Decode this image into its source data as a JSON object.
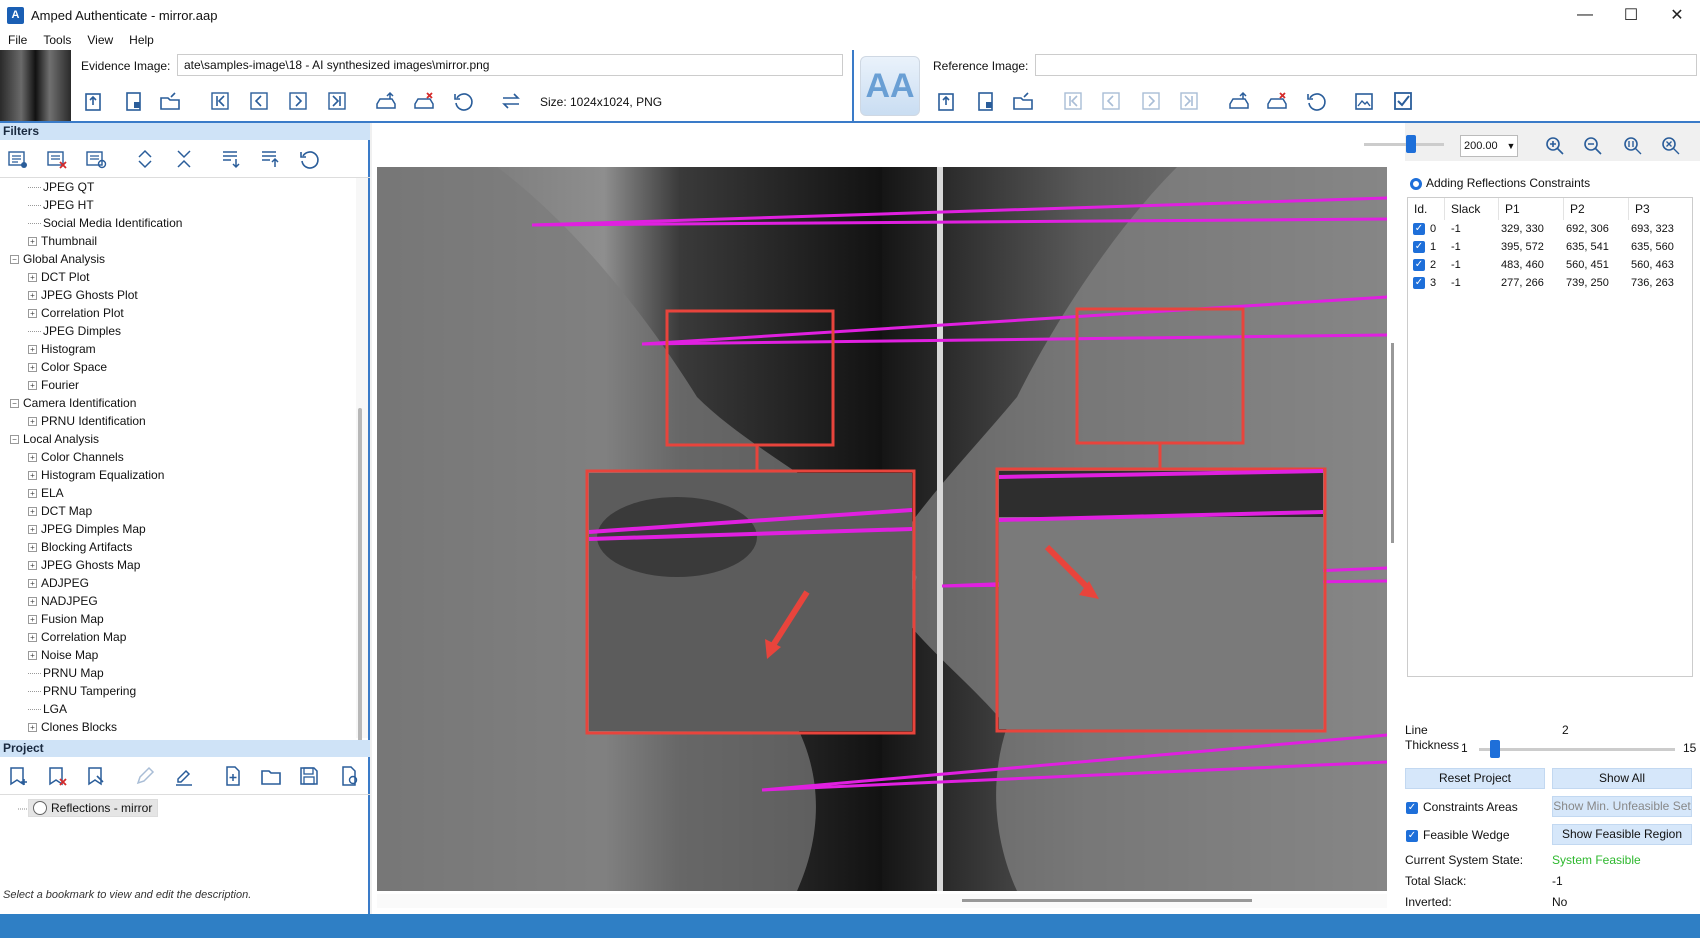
{
  "window": {
    "title": "Amped Authenticate - mirror.aap",
    "logo_text": "A",
    "minimize": "—",
    "maximize": "☐",
    "close": "✕"
  },
  "menu": [
    "File",
    "Tools",
    "View",
    "Help"
  ],
  "evidence": {
    "label": "Evidence Image:",
    "path": "ate\\samples-image\\18 - AI synthesized images\\mirror.png",
    "size_info": "Size: 1024x1024, PNG"
  },
  "reference": {
    "label": "Reference Image:",
    "path": "",
    "logo_text": "AA"
  },
  "filters": {
    "header": "Filters",
    "tree": [
      {
        "label": "JPEG QT",
        "level": 2,
        "expandable": false
      },
      {
        "label": "JPEG HT",
        "level": 2,
        "expandable": false
      },
      {
        "label": "Social Media Identification",
        "level": 2,
        "expandable": false
      },
      {
        "label": "Thumbnail",
        "level": 2,
        "expandable": true
      },
      {
        "label": "Global Analysis",
        "level": 1,
        "expandable": true,
        "expanded": true
      },
      {
        "label": "DCT Plot",
        "level": 2,
        "expandable": true
      },
      {
        "label": "JPEG Ghosts Plot",
        "level": 2,
        "expandable": true
      },
      {
        "label": "Correlation Plot",
        "level": 2,
        "expandable": true
      },
      {
        "label": "JPEG Dimples",
        "level": 2,
        "expandable": false
      },
      {
        "label": "Histogram",
        "level": 2,
        "expandable": true
      },
      {
        "label": "Color Space",
        "level": 2,
        "expandable": true
      },
      {
        "label": "Fourier",
        "level": 2,
        "expandable": true
      },
      {
        "label": "Camera Identification",
        "level": 1,
        "expandable": true,
        "expanded": true
      },
      {
        "label": "PRNU Identification",
        "level": 2,
        "expandable": true
      },
      {
        "label": "Local Analysis",
        "level": 1,
        "expandable": true,
        "expanded": true
      },
      {
        "label": "Color Channels",
        "level": 2,
        "expandable": true
      },
      {
        "label": "Histogram Equalization",
        "level": 2,
        "expandable": true
      },
      {
        "label": "ELA",
        "level": 2,
        "expandable": true
      },
      {
        "label": "DCT Map",
        "level": 2,
        "expandable": true
      },
      {
        "label": "JPEG Dimples Map",
        "level": 2,
        "expandable": true
      },
      {
        "label": "Blocking Artifacts",
        "level": 2,
        "expandable": true
      },
      {
        "label": "JPEG Ghosts Map",
        "level": 2,
        "expandable": true
      },
      {
        "label": "ADJPEG",
        "level": 2,
        "expandable": true
      },
      {
        "label": "NADJPEG",
        "level": 2,
        "expandable": true
      },
      {
        "label": "Fusion Map",
        "level": 2,
        "expandable": true
      },
      {
        "label": "Correlation Map",
        "level": 2,
        "expandable": true
      },
      {
        "label": "Noise Map",
        "level": 2,
        "expandable": true
      },
      {
        "label": "PRNU Map",
        "level": 2,
        "expandable": false
      },
      {
        "label": "PRNU Tampering",
        "level": 2,
        "expandable": false
      },
      {
        "label": "LGA",
        "level": 2,
        "expandable": false
      },
      {
        "label": "Clones Blocks",
        "level": 2,
        "expandable": true
      }
    ]
  },
  "project": {
    "header": "Project",
    "item": "Reflections - mirror",
    "description": "Select a bookmark to view and edit the description."
  },
  "viewer": {
    "zoom": "200.00",
    "zoom_level": 0.5
  },
  "constraints": {
    "mode_label": "Adding Reflections Constraints",
    "columns": [
      "Id.",
      "Slack",
      "P1",
      "P2",
      "P3"
    ],
    "rows": [
      {
        "id": "0",
        "slack": "-1",
        "p1": "329, 330",
        "p2": "692, 306",
        "p3": "693, 323",
        "checked": true
      },
      {
        "id": "1",
        "slack": "-1",
        "p1": "395, 572",
        "p2": "635, 541",
        "p3": "635, 560",
        "checked": true
      },
      {
        "id": "2",
        "slack": "-1",
        "p1": "483, 460",
        "p2": "560, 451",
        "p3": "560, 463",
        "checked": true
      },
      {
        "id": "3",
        "slack": "-1",
        "p1": "277, 266",
        "p2": "739, 250",
        "p3": "736, 263",
        "checked": true
      }
    ],
    "line_label_1": "Line",
    "line_label_2": "Thickness",
    "thickness_min": "1",
    "thickness_max": "15",
    "thickness_value": "2",
    "reset_project": "Reset Project",
    "show_all": "Show All",
    "constraints_areas": "Constraints Areas",
    "show_min_unfeasible": "Show Min. Unfeasible Set",
    "feasible_wedge": "Feasible Wedge",
    "show_feasible_region": "Show Feasible Region",
    "system_state_label": "Current System State:",
    "system_state_value": "System Feasible",
    "total_slack_label": "Total Slack:",
    "total_slack_value": "-1",
    "inverted_label": "Inverted:",
    "inverted_value": "No"
  },
  "colors": {
    "accent": "#2f7fc5",
    "panel_header": "#cfe3f7",
    "magenta_line": "#e020e0",
    "red_box": "#e8443c",
    "feasible_green": "#2eb82e"
  }
}
